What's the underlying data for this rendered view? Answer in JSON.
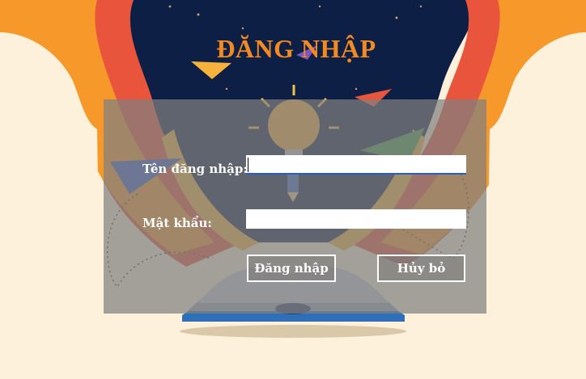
{
  "page": {
    "title": "ĐĂNG NHẬP"
  },
  "form": {
    "username_label": "Tên đăng nhập:",
    "username_value": "",
    "password_label": "Mật khẩu:",
    "password_value": "",
    "login_button": "Đăng nhập",
    "cancel_button": "Hủy bỏ"
  },
  "colors": {
    "title": "#f08a24",
    "sky": "#0e1f45",
    "page_background": "#fdf1db",
    "panel_overlay": "#808080"
  },
  "icons": [
    "paper-plane-icon",
    "light-bulb-icon",
    "pencil-icon",
    "open-book-icon",
    "sparkle-icon"
  ]
}
